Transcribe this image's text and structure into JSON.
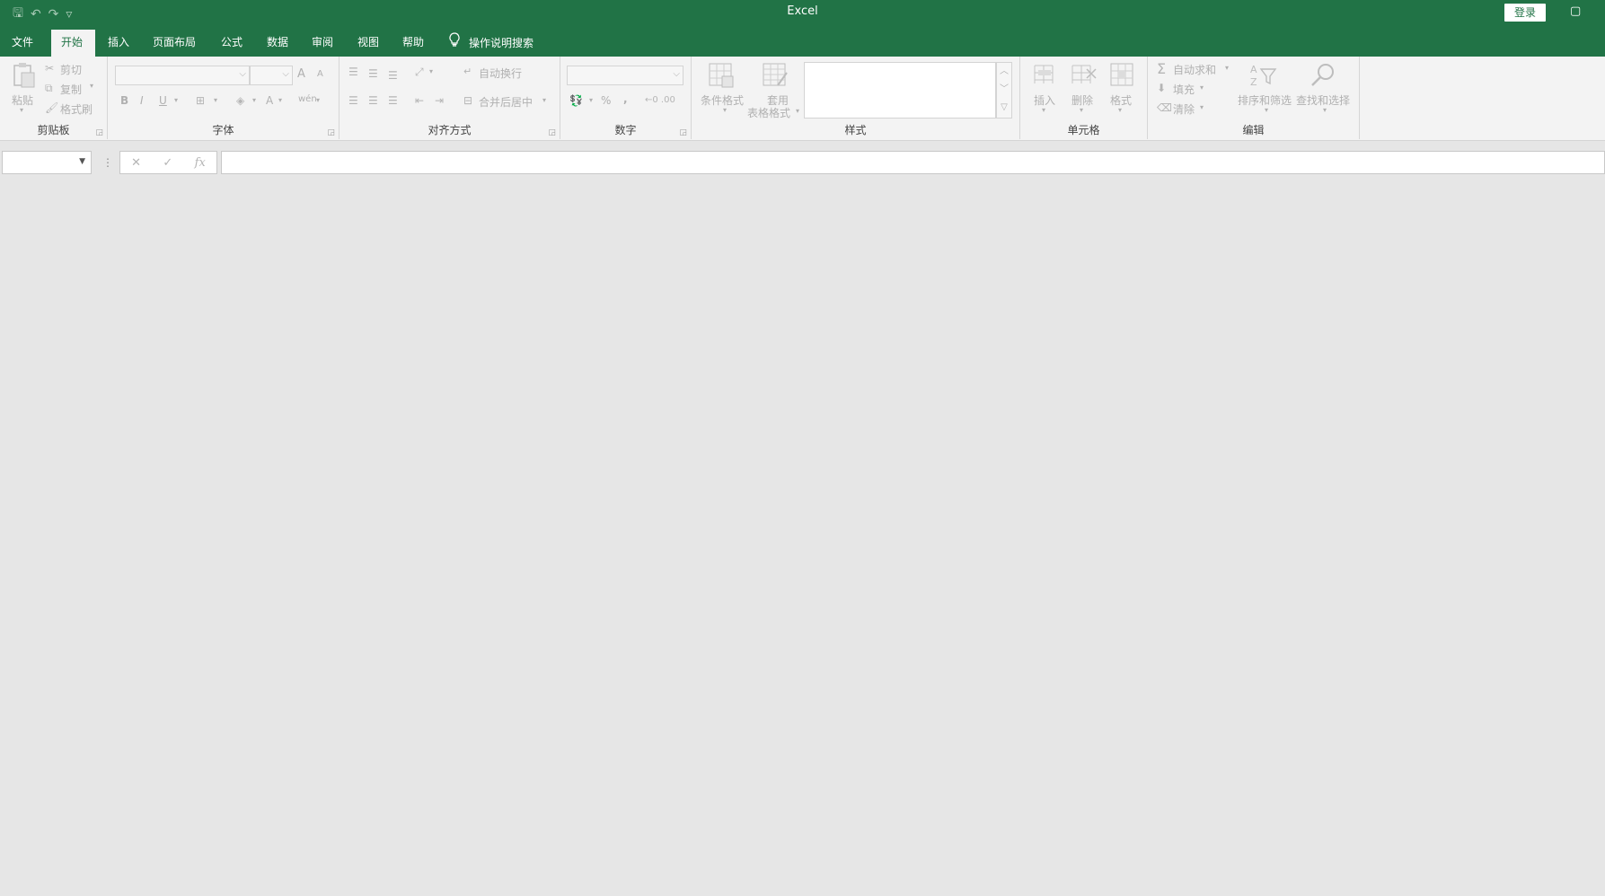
{
  "app": {
    "title": "Excel",
    "login_label": "登录",
    "restore_icon": "▢"
  },
  "qat": {
    "save_icon": "🖫",
    "undo_icon": "↶",
    "redo_icon": "↷",
    "customize_icon": "▿"
  },
  "tabs": [
    {
      "label": "文件"
    },
    {
      "label": "开始"
    },
    {
      "label": "插入"
    },
    {
      "label": "页面布局"
    },
    {
      "label": "公式"
    },
    {
      "label": "数据"
    },
    {
      "label": "审阅"
    },
    {
      "label": "视图"
    },
    {
      "label": "帮助"
    }
  ],
  "active_tab": "开始",
  "tell_me": {
    "label": "操作说明搜索",
    "icon": "lightbulb-icon"
  },
  "ribbon": {
    "clipboard": {
      "label": "剪贴板",
      "paste": "粘贴",
      "cut": "剪切",
      "copy": "复制",
      "format_painter": "格式刷"
    },
    "font": {
      "label": "字体",
      "bold": "B",
      "italic": "I",
      "underline": "U",
      "grow": "A",
      "shrink": "A",
      "font_color": "A",
      "phonetic": "wén"
    },
    "alignment": {
      "label": "对齐方式",
      "wrap_text": "自动换行",
      "merge_center": "合并后居中"
    },
    "number": {
      "label": "数字",
      "percent": "%",
      "comma": ","
    },
    "styles": {
      "label": "样式",
      "conditional_format": "条件格式",
      "format_as_table_line1": "套用",
      "format_as_table_line2": "表格格式"
    },
    "cells": {
      "label": "单元格",
      "insert": "插入",
      "delete": "删除",
      "format": "格式"
    },
    "editing": {
      "label": "编辑",
      "autosum": "自动求和",
      "fill": "填充",
      "clear": "清除",
      "sort_filter": "排序和筛选",
      "find_select": "查找和选择"
    }
  },
  "formula_bar": {
    "name_box_value": "",
    "formula_value": "",
    "cancel_icon": "✕",
    "enter_icon": "✓",
    "fx_label": "fx"
  },
  "colors": {
    "brand_green": "#217346",
    "ribbon_bg": "#f3f3f3",
    "workspace_bg": "#e6e6e6",
    "disabled_text": "#b0b0b0"
  }
}
